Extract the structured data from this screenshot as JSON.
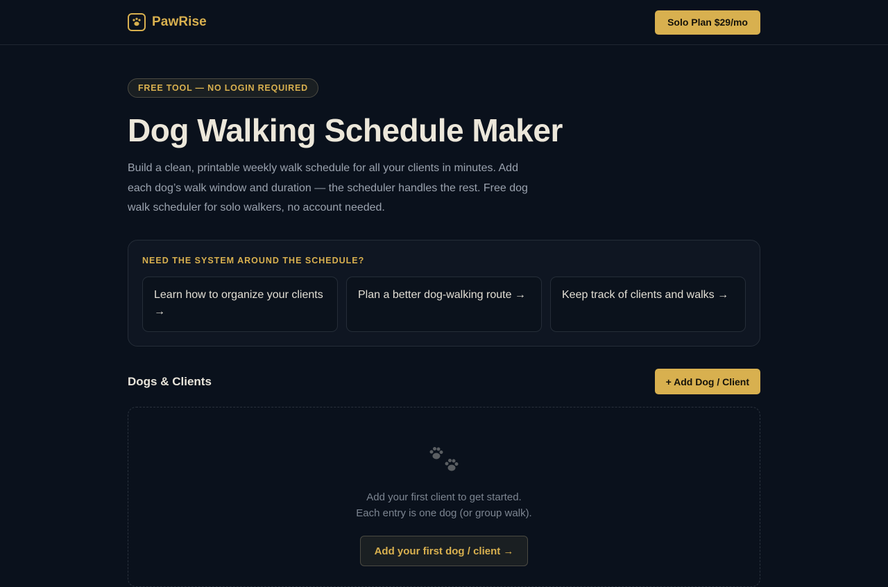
{
  "header": {
    "brand_name": "PawRise",
    "plan_button": "Solo Plan $29/mo"
  },
  "hero": {
    "badge": "FREE TOOL — NO LOGIN REQUIRED",
    "title": "Dog Walking Schedule Maker",
    "subtitle": "Build a clean, printable weekly walk schedule for all your clients in minutes. Add each dog’s walk window and duration — the scheduler handles the rest. Free dog walk scheduler for solo walkers, no account needed."
  },
  "help": {
    "heading": "NEED THE SYSTEM AROUND THE SCHEDULE?",
    "links": [
      {
        "label": "Learn how to organize your clients →"
      },
      {
        "label": "Plan a better dog-walking route →"
      },
      {
        "label": "Keep track of clients and walks →"
      }
    ]
  },
  "clients": {
    "section_title": "Dogs & Clients",
    "add_button": "+ Add Dog / Client",
    "empty_icon": "paw-prints-icon",
    "empty_line1": "Add your first client to get started.",
    "empty_line2": "Each entry is one dog (or group walk).",
    "first_button": "Add your first dog / client →"
  },
  "colors": {
    "background": "#0a111c",
    "accent": "#d8b04f",
    "text": "#ece7da",
    "muted": "#9aa2ae"
  }
}
